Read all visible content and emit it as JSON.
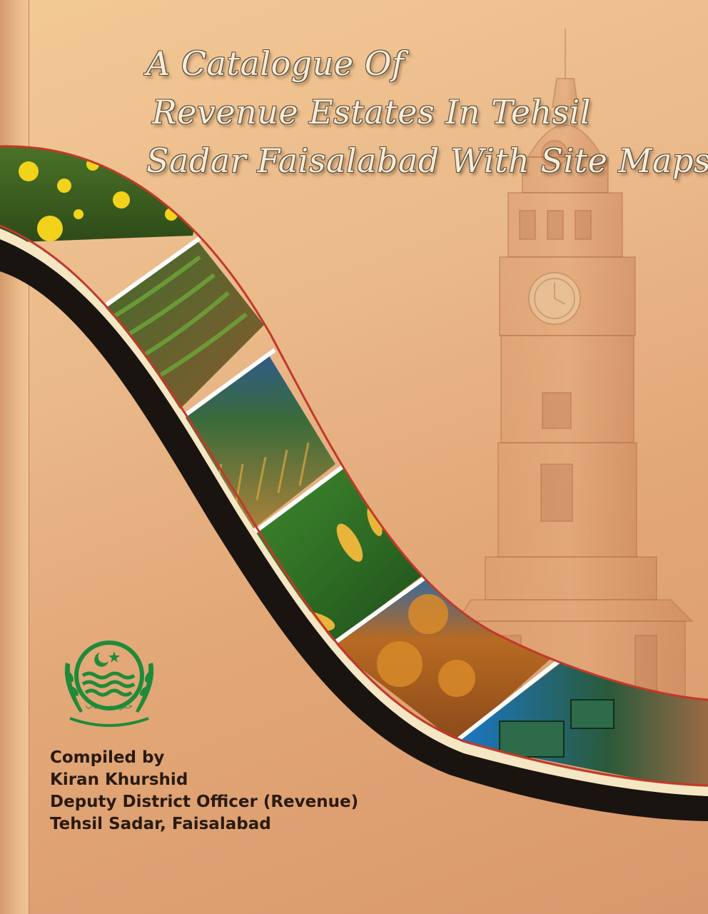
{
  "book": {
    "title_lines": [
      "A Catalogue Of",
      "Revenue Estates In Tehsil",
      "Sadar Faisalabad With Site Maps"
    ],
    "credits": {
      "compiled_by": "Compiled by",
      "author": "Kiran Khurshid",
      "designation": "Deputy District Officer (Revenue)",
      "office": "Tehsil Sadar, Faisalabad"
    }
  },
  "emblem": {
    "icon": "punjab-government-emblem-icon",
    "caption": "حکومت پنجاب"
  },
  "images": {
    "tower": "clock-tower-icon",
    "ribbon_panels": [
      "mustard-flowers",
      "crop-rows",
      "wheat-field",
      "corn-cobs",
      "autumn-tree",
      "harvester"
    ]
  },
  "colors": {
    "cover_top": "#f3c994",
    "cover_bottom": "#d9986b",
    "ribbon_outline": "#1a1410",
    "ribbon_accent": "#c0392b",
    "emblem_green": "#1f8a3a",
    "text_dark": "#2a1a10"
  }
}
